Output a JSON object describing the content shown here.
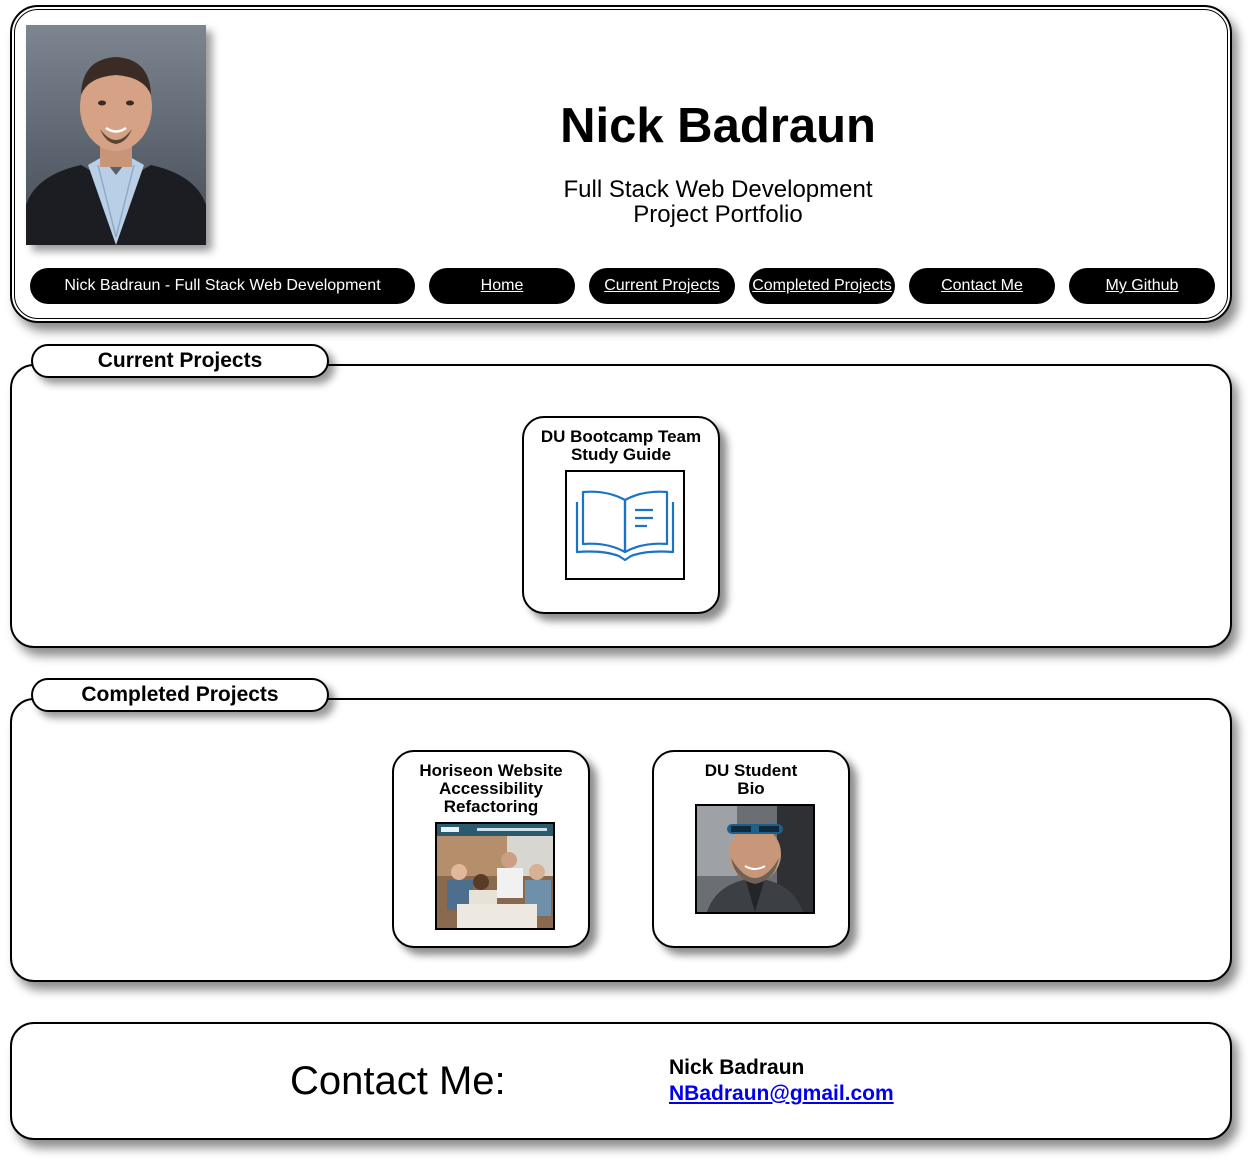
{
  "header": {
    "name": "Nick Badraun",
    "subtitle_line1": "Full Stack Web Development",
    "subtitle_line2": "Project Portfolio",
    "avatar_icon": "profile-photo"
  },
  "nav": {
    "brand": "Nick Badraun - Full Stack Web Development",
    "items": [
      "Home",
      "Current Projects",
      "Completed Projects",
      "Contact Me",
      "My Github"
    ]
  },
  "current_projects": {
    "heading": "Current Projects",
    "cards": [
      {
        "title": "DU Bootcamp Team Study Guide",
        "thumb_icon": "open-book-icon"
      }
    ]
  },
  "completed_projects": {
    "heading": "Completed Projects",
    "cards": [
      {
        "title": "Horiseon Website Accessibility Refactoring",
        "thumb_icon": "horiseon-screenshot"
      },
      {
        "title": "DU Student Bio",
        "thumb_icon": "student-photo"
      }
    ]
  },
  "contact": {
    "heading": "Contact Me:",
    "name": "Nick Badraun",
    "email": "NBadraun@gmail.com"
  },
  "colors": {
    "accent": "#000000",
    "link": "#0000ee",
    "book_icon": "#1a73c8"
  }
}
